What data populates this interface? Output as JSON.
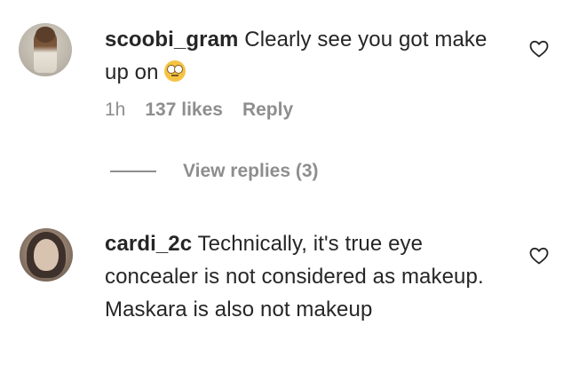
{
  "comments": [
    {
      "username": "scoobi_gram",
      "text": "Clearly see you got make up on",
      "emoji": "rolling-eyes-emoji",
      "time": "1h",
      "likes": "137 likes",
      "reply_label": "Reply",
      "view_replies": "View replies (3)"
    },
    {
      "username": "cardi_2c",
      "text": "Technically, it's true eye concealer is not considered as makeup. Maskara is also not makeup"
    }
  ],
  "icons": {
    "like": "heart-outline-icon"
  }
}
